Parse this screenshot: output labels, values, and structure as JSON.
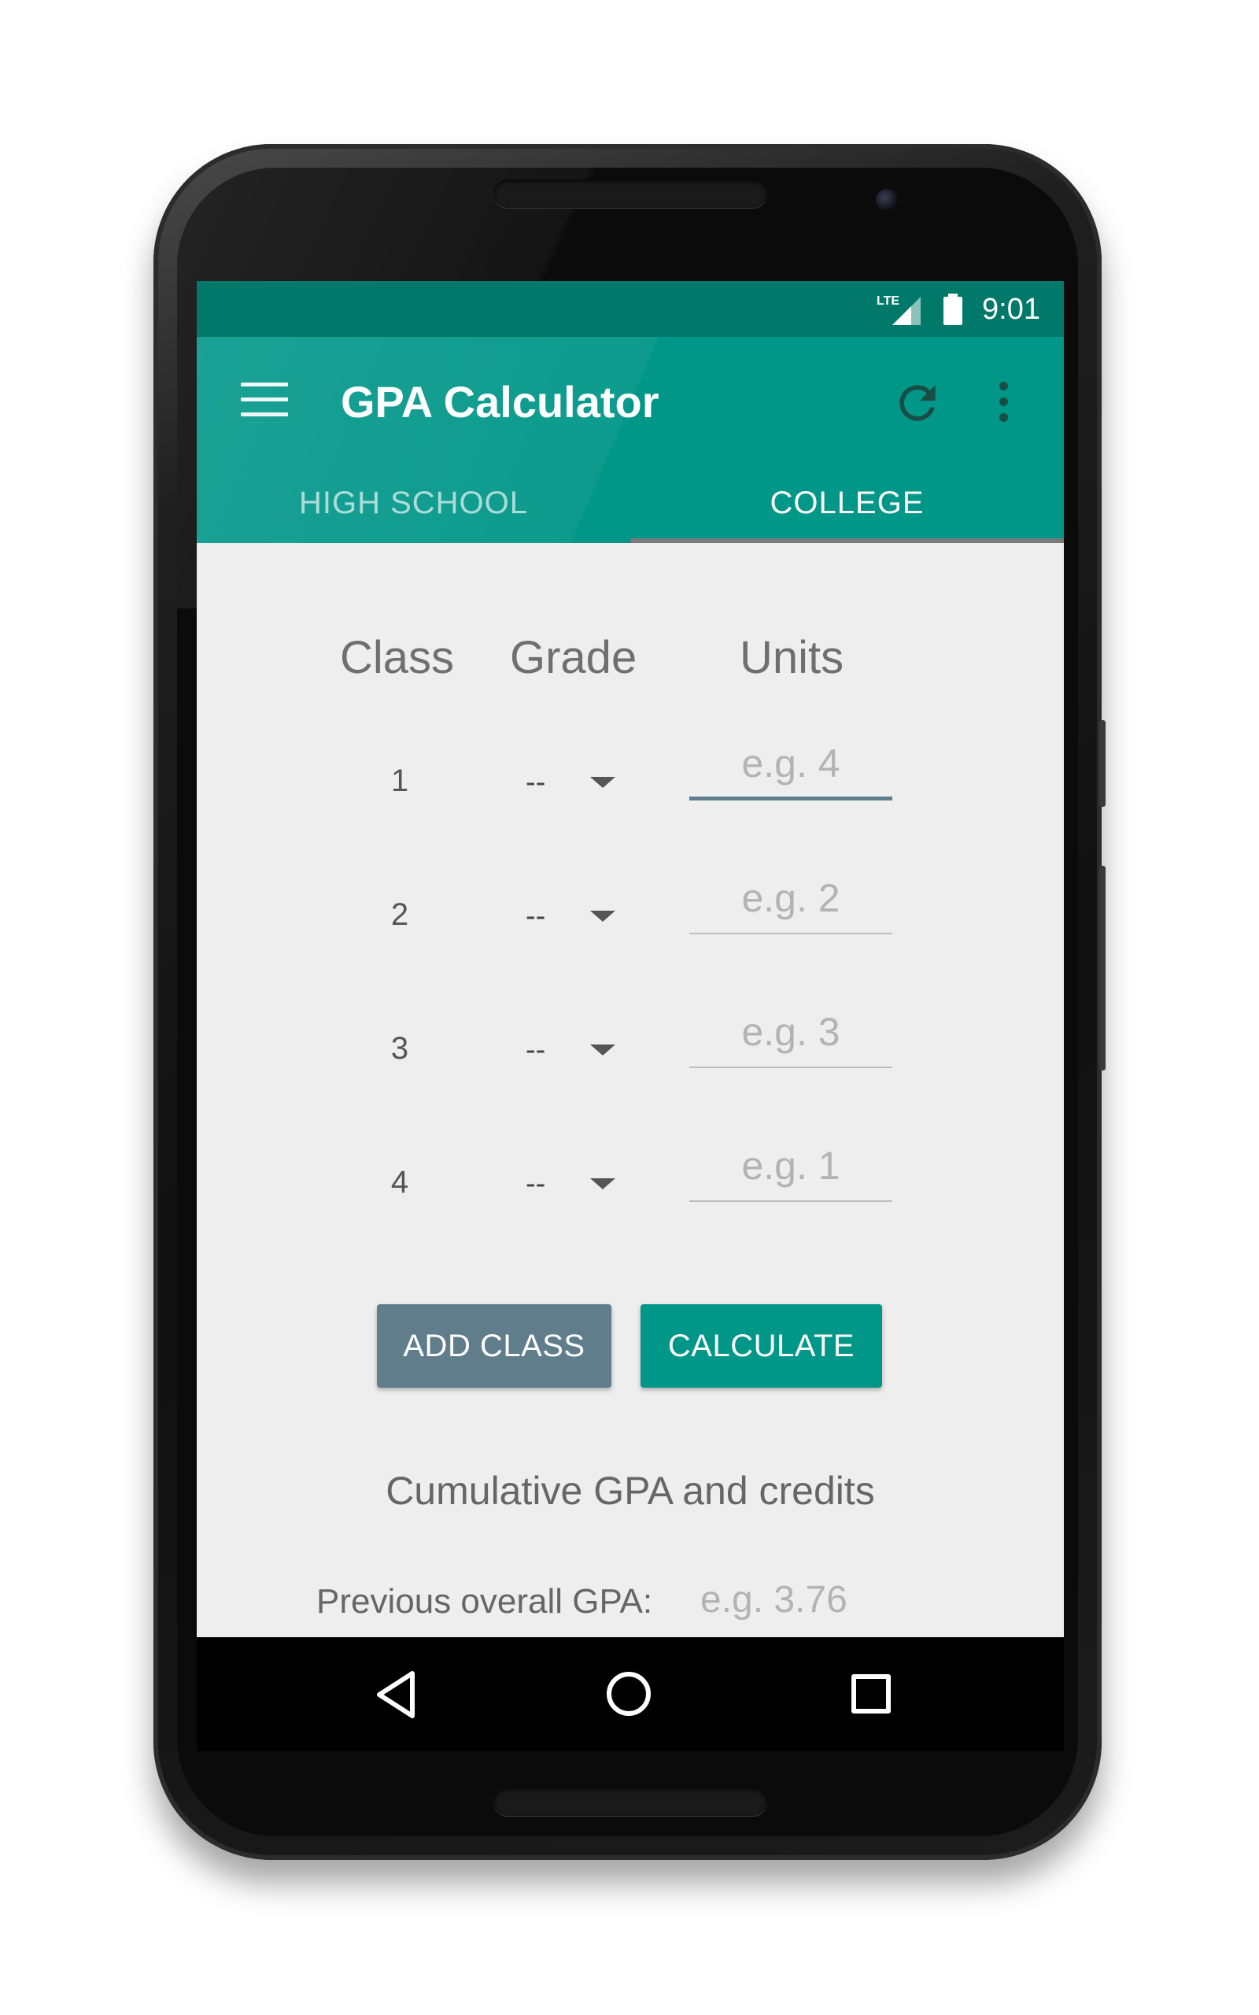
{
  "status_bar": {
    "network": "LTE",
    "time": "9:01"
  },
  "app": {
    "title": "GPA Calculator",
    "menu_icon": "hamburger-menu-icon",
    "refresh_icon": "refresh-icon",
    "overflow_icon": "more-vert-icon",
    "primary_color": "#009688",
    "status_color": "#00796b"
  },
  "tabs": [
    {
      "label": "HIGH SCHOOL",
      "active": false
    },
    {
      "label": "COLLEGE",
      "active": true
    }
  ],
  "columns": {
    "class": "Class",
    "grade": "Grade",
    "units": "Units"
  },
  "rows": [
    {
      "number": "1",
      "grade": "--",
      "units_placeholder": "e.g. 4"
    },
    {
      "number": "2",
      "grade": "--",
      "units_placeholder": "e.g. 2"
    },
    {
      "number": "3",
      "grade": "--",
      "units_placeholder": "e.g. 3"
    },
    {
      "number": "4",
      "grade": "--",
      "units_placeholder": "e.g. 1"
    }
  ],
  "buttons": {
    "add_class": "ADD CLASS",
    "calculate": "CALCULATE",
    "add_class_color": "#607d8b"
  },
  "cumulative": {
    "title": "Cumulative GPA and credits",
    "prev_gpa_label": "Previous overall GPA:",
    "prev_gpa_placeholder": "e.g. 3.76"
  },
  "nav": {
    "back_icon": "back-triangle-icon",
    "home_icon": "home-circle-icon",
    "recents_icon": "recents-square-icon"
  }
}
